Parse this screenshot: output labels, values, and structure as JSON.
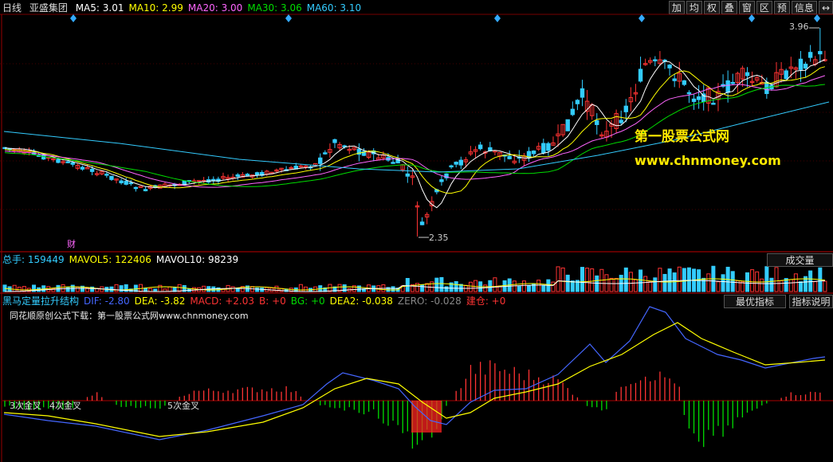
{
  "header": {
    "period": "日线",
    "stock": "亚盛集团",
    "ma": [
      {
        "label": "MA5: 3.01",
        "color": "#ffffff"
      },
      {
        "label": "MA10: 2.99",
        "color": "#ffff00"
      },
      {
        "label": "MA20: 3.00",
        "color": "#ff66ff"
      },
      {
        "label": "MA30: 3.06",
        "color": "#00dd00"
      },
      {
        "label": "MA60: 3.10",
        "color": "#33ccff"
      }
    ]
  },
  "toolbar": [
    "加",
    "均",
    "权",
    "叠",
    "窗",
    "区",
    "预",
    "信息",
    "↔"
  ],
  "price_panel": {
    "high_label": "3.96",
    "low_label": "2.35",
    "fin_mark": "财",
    "watermark_cn": "第一股票公式网",
    "watermark_url": "www.chnmoney.com"
  },
  "volume_panel": {
    "legend": [
      {
        "label": "总手: 159449",
        "color": "#33ccff"
      },
      {
        "label": "MAVOL5: 122406",
        "color": "#ffff00"
      },
      {
        "label": "MAVOL10: 98239",
        "color": "#ffffff"
      }
    ],
    "button": "成交量"
  },
  "indicator_panel": {
    "legend": [
      {
        "label": "黑马定量拉升结构",
        "color": "#33ccff"
      },
      {
        "label": "DIF: -2.80",
        "color": "#4466ff"
      },
      {
        "label": "DEA: -3.82",
        "color": "#ffff00"
      },
      {
        "label": "MACD: +2.03",
        "color": "#ff3333"
      },
      {
        "label": "B: +0",
        "color": "#ff3333"
      },
      {
        "label": "BG: +0",
        "color": "#00dd00"
      },
      {
        "label": "DEA2: -0.038",
        "color": "#ffff00"
      },
      {
        "label": "ZERO: -0.028",
        "color": "#888888"
      },
      {
        "label": "建仓: +0",
        "color": "#ff3333"
      }
    ],
    "buttons": [
      "最优指标",
      "指标说明"
    ],
    "note": "同花顺原创公式下载：第一股票公式网www.chnmoney.com",
    "signals": [
      "3次金叉",
      "4次金叉",
      "5次金叉"
    ]
  },
  "colors": {
    "up": "#ff3333",
    "down": "#33ccff",
    "dif": "#4466ff",
    "dea": "#ffff00",
    "axis": "#aa0000",
    "ma5": "#ffffff",
    "ma10": "#ffff00",
    "ma20": "#ff66ff",
    "ma30": "#00dd00",
    "ma60": "#33ccff",
    "vol_up": "#ff3333",
    "vol_down": "#33ccff",
    "pos_hist": "#ff3333",
    "neg_hist": "#00dd00"
  }
}
